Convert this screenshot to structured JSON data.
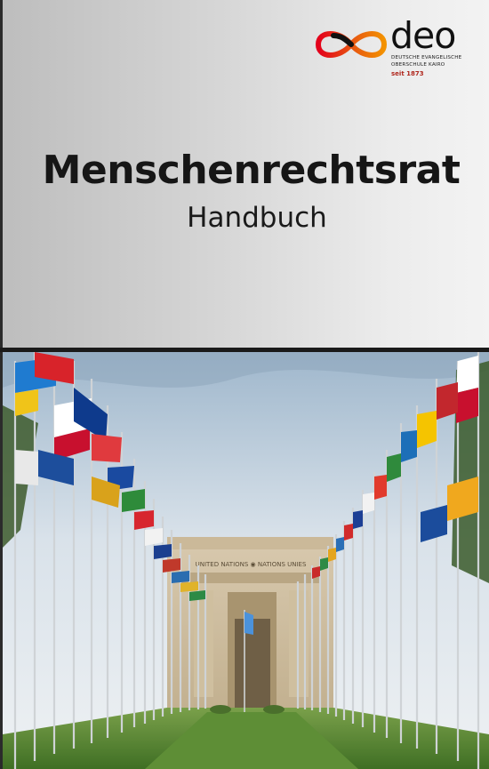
{
  "logo": {
    "wordmark": "deo",
    "school_name": "DEUTSCHE EVANGELISCHE\nOBERSCHULE KAIRO",
    "since": "seit 1873",
    "colors": {
      "red": "#e3001b",
      "orange": "#f39200",
      "black": "#111111"
    }
  },
  "cover": {
    "title": "Menschenrechtsrat",
    "subtitle": "Handbuch"
  },
  "photo": {
    "building_inscription": "UNITED NATIONS  ◉  NATIONS UNIES"
  }
}
